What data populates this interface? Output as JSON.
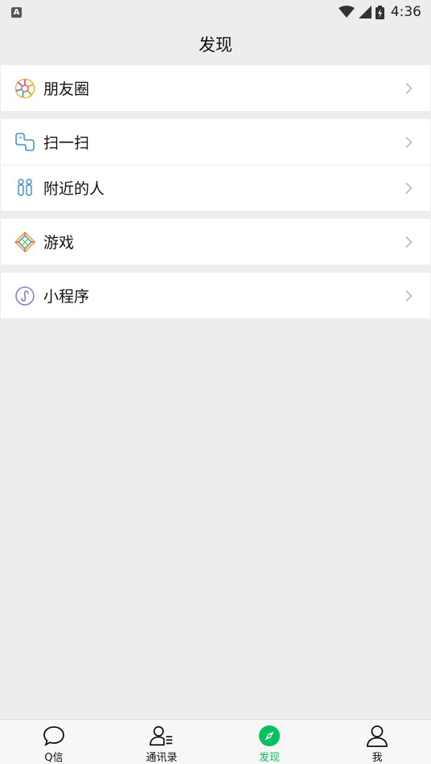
{
  "status_bar": {
    "notification_badge": "A",
    "time": "4:36"
  },
  "header": {
    "title": "发现"
  },
  "menu": {
    "moments": "朋友圈",
    "scan": "扫一扫",
    "nearby": "附近的人",
    "games": "游戏",
    "mini_programs": "小程序"
  },
  "tabbar": {
    "active_color": "#07c160",
    "tabs": [
      {
        "label": "Q信"
      },
      {
        "label": "通讯录"
      },
      {
        "label": "发现"
      },
      {
        "label": "我"
      }
    ]
  }
}
